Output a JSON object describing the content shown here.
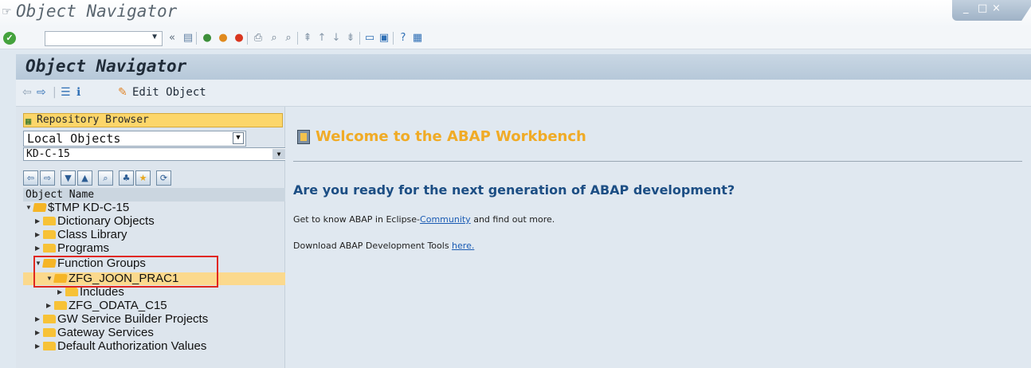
{
  "window": {
    "title": "Object Navigator",
    "controls": [
      "_",
      "□",
      "×"
    ]
  },
  "std_toolbar": {
    "command_value": "",
    "icons": [
      "enter-icon",
      "back-icon",
      "exit-icon",
      "cancel-icon",
      "print-icon",
      "find-icon",
      "find-next-icon",
      "first-page-icon",
      "prev-page-icon",
      "next-page-icon",
      "last-page-icon",
      "new-session-icon",
      "shortcut-icon",
      "help-icon",
      "customize-layout-icon"
    ]
  },
  "page": {
    "title": "Object Navigator",
    "edit_object_label": "Edit Object"
  },
  "left": {
    "repository_browser_label": "Repository Browser",
    "object_type": "Local Objects",
    "package": "KD-C-15",
    "column_header": "Object Name",
    "tree": {
      "root": "$TMP KD-C-15",
      "dictionary": "Dictionary Objects",
      "class_library": "Class Library",
      "programs": "Programs",
      "function_groups": "Function Groups",
      "fg1": "ZFG_JOON_PRAC1",
      "includes": "Includes",
      "fg2": "ZFG_ODATA_C15",
      "gw_projects": "GW Service Builder Projects",
      "gw_services": "Gateway Services",
      "default_auth": "Default Authorization Values"
    }
  },
  "content": {
    "welcome": "Welcome to the ABAP Workbench",
    "heading": "Are you ready for the next generation of ABAP development?",
    "para1_before": "Get to know ABAP in Eclipse-",
    "para1_link": "Community",
    "para1_after": " and find out more.",
    "para2_before": "Download ABAP Development Tools ",
    "para2_link": "here."
  },
  "colors": {
    "accent_orange": "#f0ab26",
    "heading_blue": "#1c4e84",
    "highlight_red": "#e0271f",
    "selection": "#fbd98d"
  }
}
